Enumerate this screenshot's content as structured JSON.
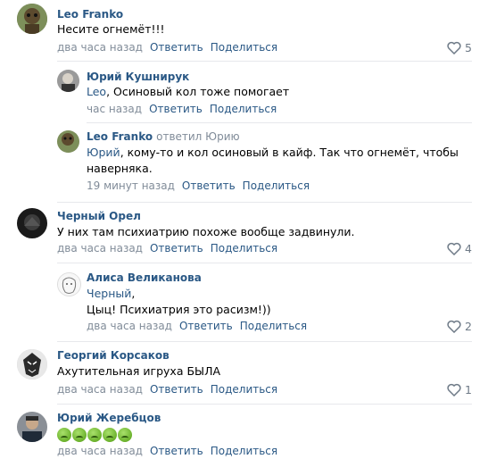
{
  "comments": [
    {
      "author": "Leo Franko",
      "text": "Несите огнемёт!!!",
      "time": "два часа назад",
      "reply": "Ответить",
      "share": "Поделиться",
      "likes": "5"
    },
    {
      "author": "Юрий Кушнирук",
      "mention": "Leo",
      "text": ", Осиновый кол тоже помогает",
      "time": "час назад",
      "reply": "Ответить",
      "share": "Поделиться"
    },
    {
      "author": "Leo Franko",
      "reply_to": "ответил Юрию",
      "mention": "Юрий",
      "text_line1": ", кому-то и кол осиновый в кайф. Так что огнемёт, чтобы",
      "text_line2": "наверняка.",
      "time": "19 минут назад",
      "reply": "Ответить",
      "share": "Поделиться"
    },
    {
      "author": "Черный Орел",
      "text": "У них там психиатрию похоже вообще задвинули.",
      "time": "два часа назад",
      "reply": "Ответить",
      "share": "Поделиться",
      "likes": "4"
    },
    {
      "author": "Алиса Великанова",
      "mention": "Черный",
      "text_line1": ",",
      "text_line2": "Цыц! Психиатрия это расизм!))",
      "time": "два часа назад",
      "reply": "Ответить",
      "share": "Поделиться",
      "likes": "2"
    },
    {
      "author": "Георгий Корсаков",
      "text": "Ахутительная игруха БЫЛА",
      "time": "два часа назад",
      "reply": "Ответить",
      "share": "Поделиться",
      "likes": "1"
    },
    {
      "author": "Юрий Жеребцов",
      "emoji_count": 5,
      "time": "два часа назад",
      "reply": "Ответить",
      "share": "Поделиться"
    }
  ],
  "colors": {
    "link": "#2a5885",
    "meta": "#818c99",
    "separator": "#e7e8ec",
    "emoji": "#6bb22c"
  },
  "icons": [
    "heart-icon",
    "sick-face-emoji"
  ]
}
